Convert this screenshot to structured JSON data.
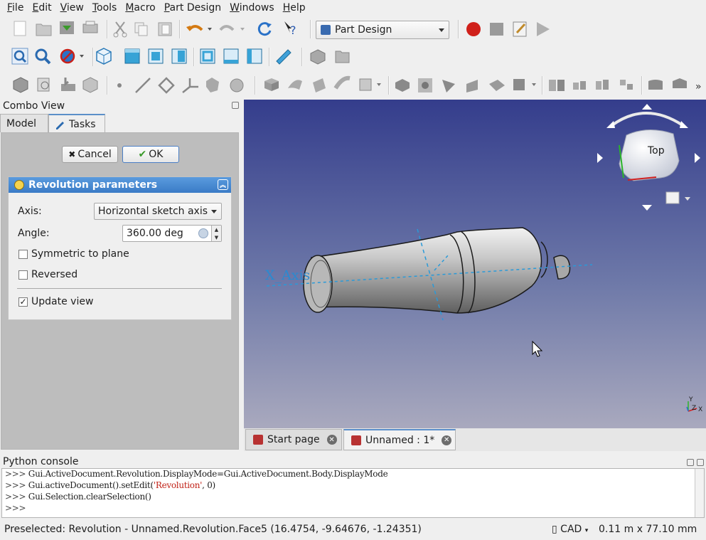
{
  "menu": [
    "File",
    "Edit",
    "View",
    "Tools",
    "Macro",
    "Part Design",
    "Windows",
    "Help"
  ],
  "workbench": {
    "selected": "Part Design",
    "icon": "part-design-icon"
  },
  "combo": {
    "title": "Combo View",
    "tabs": [
      {
        "label": "Model"
      },
      {
        "label": "Tasks"
      }
    ],
    "cancel_label": "Cancel",
    "ok_label": "OK",
    "panel": {
      "title": "Revolution parameters",
      "axis_label": "Axis:",
      "axis_value": "Horizontal sketch axis",
      "angle_label": "Angle:",
      "angle_value": "360.00 deg",
      "symmetric_label": "Symmetric to plane",
      "symmetric_checked": false,
      "reversed_label": "Reversed",
      "reversed_checked": false,
      "update_label": "Update view",
      "update_checked": true
    }
  },
  "viewport": {
    "axis_label": "X_Axis",
    "navcube_face": "Top",
    "triad_labels": [
      "Y",
      "Z",
      "X"
    ],
    "background_top": "#343d8c",
    "background_bottom": "#a9a9be"
  },
  "doc_tabs": [
    {
      "label": "Start page"
    },
    {
      "label": "Unnamed : 1*"
    }
  ],
  "console": {
    "title": "Python console",
    "prompt": ">>>",
    "lines": [
      {
        "code": "Gui.ActiveDocument.Revolution.DisplayMode=Gui.ActiveDocument.Body.DisplayMode"
      },
      {
        "code": "Gui.activeDocument().setEdit(",
        "str": "'Revolution'",
        "tail": ", 0)"
      },
      {
        "code": "Gui.Selection.clearSelection()"
      },
      {
        "code": ""
      }
    ]
  },
  "status": {
    "message": "Preselected: Revolution - Unnamed.Revolution.Face5 (16.4754, -9.64676, -1.24351)",
    "nav_style": "CAD",
    "dimensions": "0.11 m x 77.10 mm"
  },
  "colors": {
    "accent": "#3a7bc6",
    "record": "#d0201a"
  }
}
